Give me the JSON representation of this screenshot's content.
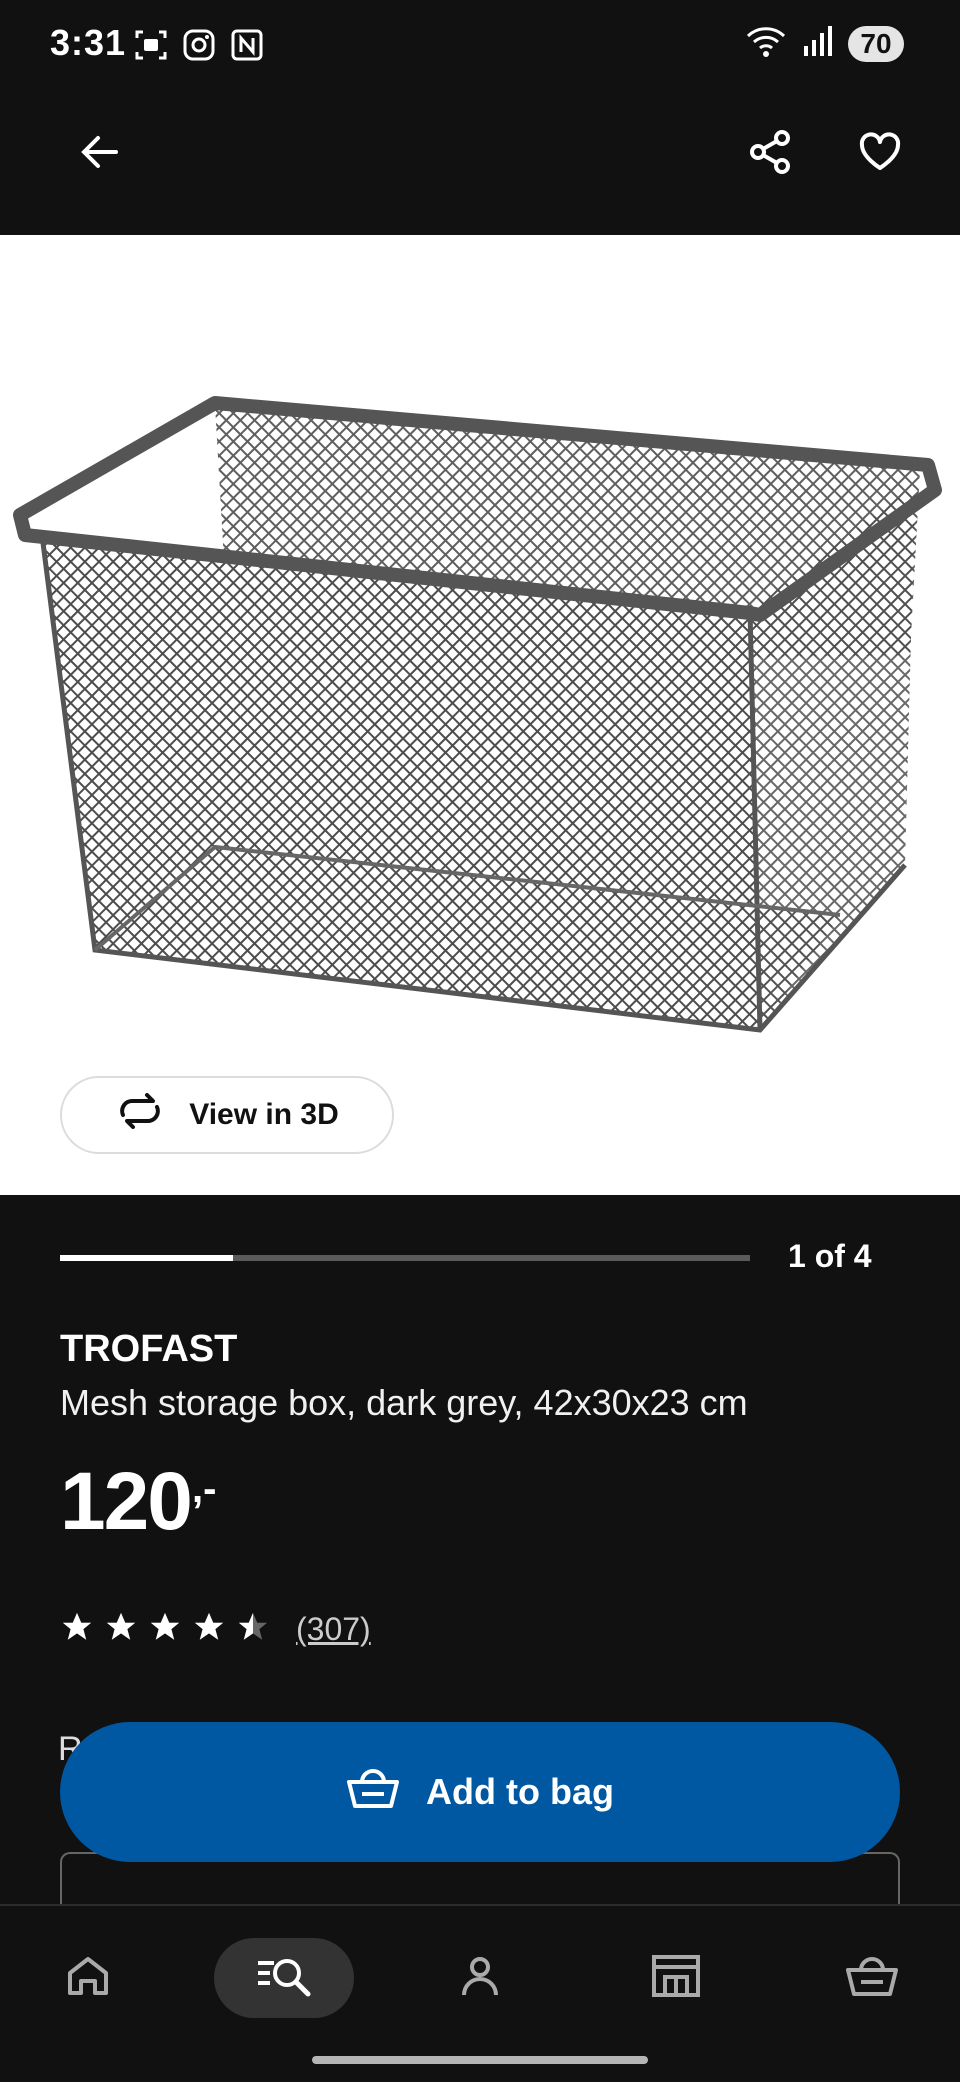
{
  "status_bar": {
    "time": "3:31",
    "battery": "70",
    "left_icons": [
      "screenshot-icon",
      "instagram-icon",
      "nfc-icon"
    ],
    "right_icons": [
      "wifi-icon",
      "signal-icon"
    ]
  },
  "app_bar": {
    "back_icon": "arrow-left-icon",
    "share_icon": "share-icon",
    "favorite_icon": "heart-icon"
  },
  "gallery": {
    "view_3d_label": "View in 3D",
    "page_counter": "1 of 4",
    "progress_fraction": 0.25
  },
  "product": {
    "brand": "TROFAST",
    "description": "Mesh storage box, dark grey, 42x30x23 cm",
    "price": "120",
    "price_suffix": ",-",
    "rating": 4.5,
    "review_count": "(307)"
  },
  "cta": {
    "add_to_bag_label": "Add to bag"
  },
  "partial": {
    "row_letter": "R"
  },
  "bottom_nav": {
    "items": [
      "home",
      "search",
      "profile",
      "store",
      "bag"
    ],
    "active": "search"
  },
  "colors": {
    "background": "#111111",
    "accent_blue": "#0058a3",
    "hero_background": "#ffffff"
  }
}
